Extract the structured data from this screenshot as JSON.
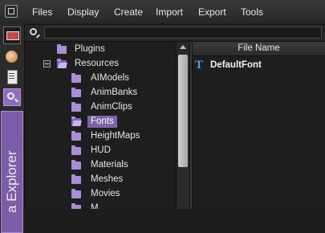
{
  "menu": [
    "Files",
    "Display",
    "Create",
    "Import",
    "Export",
    "Tools"
  ],
  "search": {
    "value": "",
    "placeholder": ""
  },
  "side_tab": {
    "label": "a Explorer"
  },
  "tree": {
    "rows": [
      {
        "label": "Plugins",
        "selected": false
      },
      {
        "label": "Resources",
        "selected": false
      },
      {
        "label": "AIModels",
        "selected": false
      },
      {
        "label": "AnimBanks",
        "selected": false
      },
      {
        "label": "AnimClips",
        "selected": false
      },
      {
        "label": "Fonts",
        "selected": true
      },
      {
        "label": "HeightMaps",
        "selected": false
      },
      {
        "label": "HUD",
        "selected": false
      },
      {
        "label": "Materials",
        "selected": false
      },
      {
        "label": "Meshes",
        "selected": false
      },
      {
        "label": "Movies",
        "selected": false
      },
      {
        "label": "M",
        "selected": false
      }
    ]
  },
  "filelist": {
    "column_header": "File Name",
    "files": [
      {
        "name": "DefaultFont",
        "icon": "font-file-icon"
      }
    ]
  },
  "colors": {
    "accent_purple": "#7e62ab",
    "folder_purple": "#a98dd8",
    "background": "#1e1e1e"
  }
}
